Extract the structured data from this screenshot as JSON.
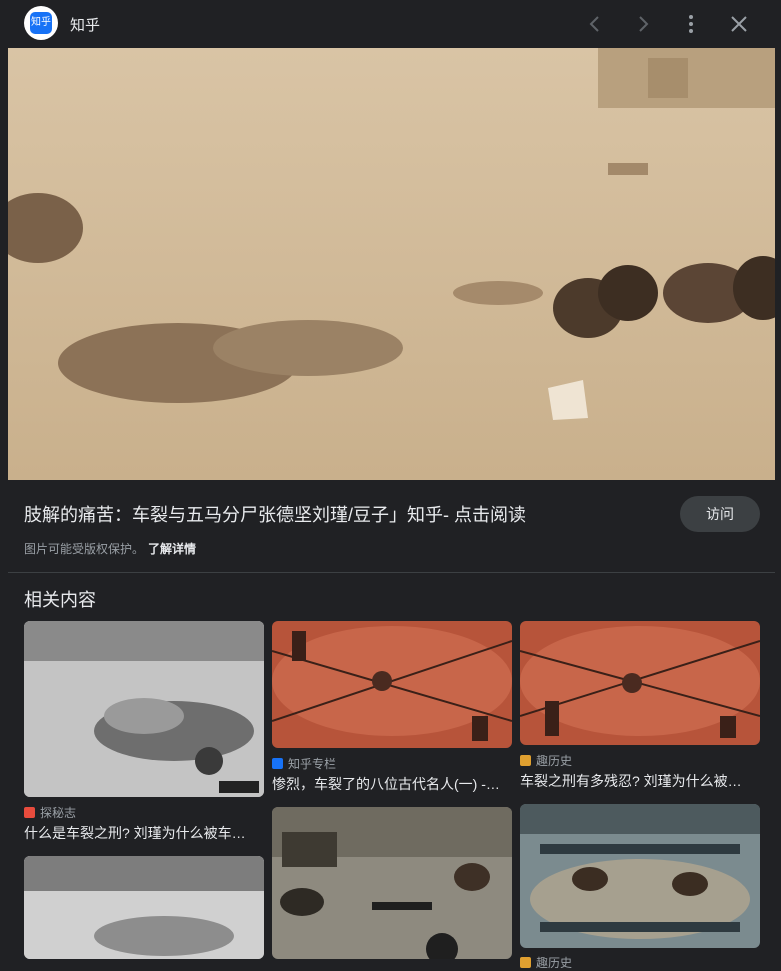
{
  "header": {
    "logo_text": "知乎",
    "site_name": "知乎",
    "icons": [
      "back-arrow-icon",
      "forward-arrow-icon",
      "more-vert-icon",
      "close-icon"
    ]
  },
  "main": {
    "caption": "肢解的痛苦：车裂与五马分尸张德坚刘瑾/豆子」知乎- 点击阅读",
    "visit_label": "访问",
    "copyright_notice": "图片可能受版权保护。",
    "learn_more": "了解详情"
  },
  "related": {
    "heading": "相关内容",
    "cards": [
      {
        "source": "探秘志",
        "title": "什么是车裂之刑? 刘瑾为什么被车…",
        "icon_color": "#e84c3d"
      },
      {
        "source": "知乎专栏",
        "title": "惨烈，车裂了的八位古代名人(一) -…",
        "icon_color": "#1772f6"
      },
      {
        "source": "趣历史",
        "title": "车裂之刑有多残忍? 刘瑾为什么被…",
        "icon_color": "#e0a030"
      },
      {
        "source": "",
        "title": ""
      },
      {
        "source": "",
        "title": ""
      },
      {
        "source": "趣历史",
        "title": ""
      }
    ]
  },
  "colors": {
    "background": "#202124",
    "accent_button": "#3c4043",
    "text_primary": "#e8eaed",
    "text_secondary": "#9aa0a6"
  }
}
